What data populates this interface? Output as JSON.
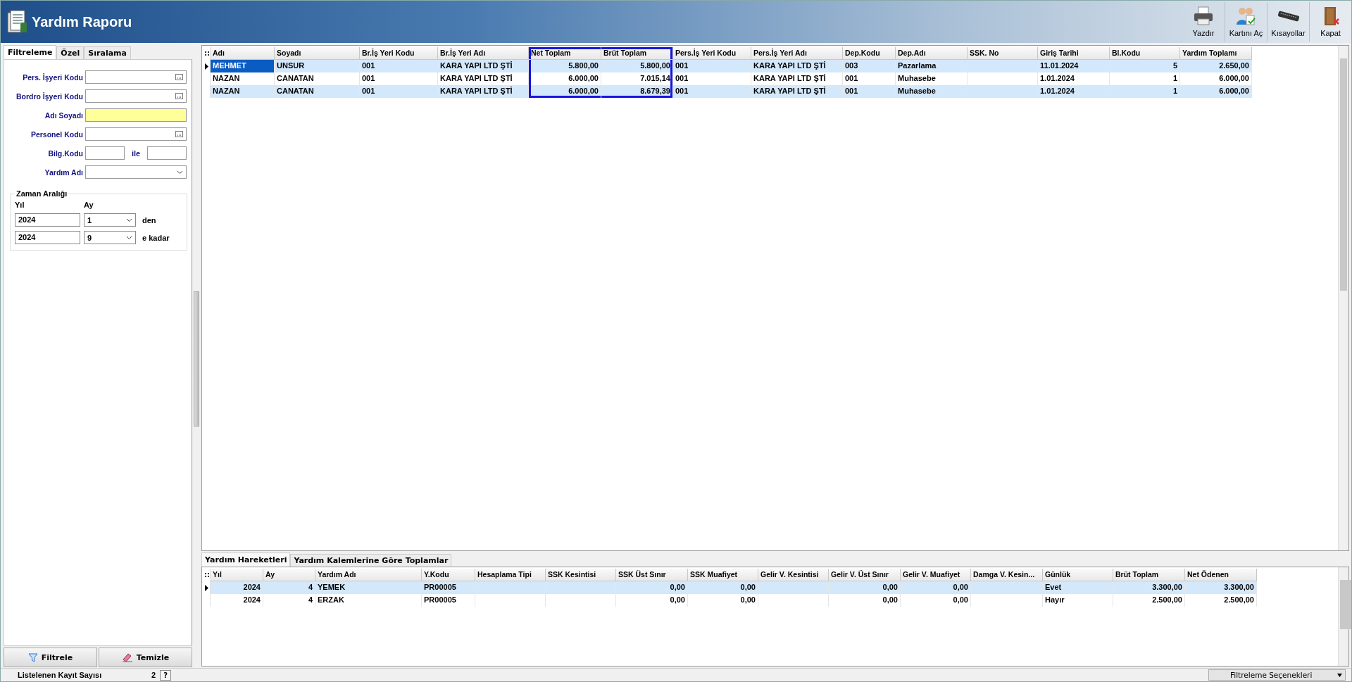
{
  "window": {
    "title": "Yardım Raporu"
  },
  "toolbar": [
    {
      "label": "Yazdır",
      "kind": "printer"
    },
    {
      "label": "Kartını Aç",
      "kind": "users"
    },
    {
      "label": "Kısayollar",
      "kind": "keyboard"
    },
    {
      "label": "Kapat",
      "kind": "exit"
    }
  ],
  "filter_panel": {
    "tabs": [
      {
        "label": "Filtreleme",
        "selected": true
      },
      {
        "label": "Özel",
        "selected": false
      },
      {
        "label": "Sıralama",
        "selected": false
      }
    ],
    "fields": [
      {
        "label": "Pers. İşyeri Kodu",
        "kind": "lookup",
        "focused": false
      },
      {
        "label": "Bordro İşyeri Kodu",
        "kind": "lookup",
        "focused": false
      },
      {
        "label": "Adı Soyadı",
        "kind": "text",
        "focused": true
      },
      {
        "label": "Personel Kodu",
        "kind": "lookup",
        "focused": false
      },
      {
        "label": "Bilg.Kodu",
        "kind": "range",
        "joiner": "ile",
        "focused": false
      },
      {
        "label": "Yardım Adı",
        "kind": "dropdown",
        "focused": false
      }
    ],
    "date_range": {
      "title": "Zaman Aralığı",
      "year_label": "Yıl",
      "month_label": "Ay",
      "rows": [
        {
          "year": "2024",
          "month": "1",
          "suffix": "den"
        },
        {
          "year": "2024",
          "month": "9",
          "suffix": "e kadar"
        }
      ]
    },
    "buttons": [
      {
        "label": "Filtrele",
        "kind": "filter"
      },
      {
        "label": "Temizle",
        "kind": "clear"
      }
    ]
  },
  "main_table": {
    "columns": [
      {
        "label": "Adı",
        "kind": "text",
        "highlighted": false
      },
      {
        "label": "Soyadı",
        "kind": "text",
        "highlighted": false
      },
      {
        "label": "Br.İş Yeri Kodu",
        "kind": "text",
        "highlighted": false
      },
      {
        "label": "Br.İş Yeri Adı",
        "kind": "text",
        "highlighted": false
      },
      {
        "label": "Net Toplam",
        "kind": "number",
        "highlighted": true
      },
      {
        "label": "Brüt Toplam",
        "kind": "number",
        "highlighted": true
      },
      {
        "label": "Pers.İş Yeri Kodu",
        "kind": "text",
        "highlighted": false
      },
      {
        "label": "Pers.İş Yeri Adı",
        "kind": "text",
        "highlighted": false
      },
      {
        "label": "Dep.Kodu",
        "kind": "text",
        "highlighted": false
      },
      {
        "label": "Dep.Adı",
        "kind": "text",
        "highlighted": false
      },
      {
        "label": "SSK. No",
        "kind": "text",
        "highlighted": false
      },
      {
        "label": "Giriş Tarihi",
        "kind": "text",
        "highlighted": false
      },
      {
        "label": "Bl.Kodu",
        "kind": "number",
        "highlighted": false
      },
      {
        "label": "Yardım Toplamı",
        "kind": "number",
        "highlighted": false
      }
    ],
    "rows": [
      {
        "selected": true,
        "cells": [
          "MEHMET",
          "UNSUR",
          "001",
          "KARA YAPI LTD ŞTİ",
          "5.800,00",
          "5.800,00",
          "001",
          "KARA YAPI LTD ŞTİ",
          "003",
          "Pazarlama",
          "",
          "11.01.2024",
          "5",
          "2.650,00"
        ]
      },
      {
        "selected": false,
        "cells": [
          "NAZAN",
          "CANATAN",
          "001",
          "KARA YAPI LTD ŞTİ",
          "6.000,00",
          "7.015,14",
          "001",
          "KARA YAPI LTD ŞTİ",
          "001",
          "Muhasebe",
          "",
          "1.01.2024",
          "1",
          "6.000,00"
        ]
      },
      {
        "selected": false,
        "cells": [
          "NAZAN",
          "CANATAN",
          "001",
          "KARA YAPI LTD ŞTİ",
          "6.000,00",
          "8.679,39",
          "001",
          "KARA YAPI LTD ŞTİ",
          "001",
          "Muhasebe",
          "",
          "1.01.2024",
          "1",
          "6.000,00"
        ]
      }
    ]
  },
  "detail_tabs": [
    {
      "label": "Yardım Hareketleri",
      "selected": true
    },
    {
      "label": "Yardım Kalemlerine Göre Toplamlar",
      "selected": false
    }
  ],
  "detail_table": {
    "columns": [
      {
        "label": "Yıl",
        "kind": "number"
      },
      {
        "label": "Ay",
        "kind": "number"
      },
      {
        "label": "Yardım Adı",
        "kind": "text"
      },
      {
        "label": "Y.Kodu",
        "kind": "text"
      },
      {
        "label": "Hesaplama Tipi",
        "kind": "text"
      },
      {
        "label": "SSK Kesintisi",
        "kind": "number"
      },
      {
        "label": "SSK Üst Sınır",
        "kind": "number"
      },
      {
        "label": "SSK Muafiyet",
        "kind": "number"
      },
      {
        "label": "Gelir V. Kesintisi",
        "kind": "number"
      },
      {
        "label": "Gelir V. Üst Sınır",
        "kind": "number"
      },
      {
        "label": "Gelir V. Muafiyet",
        "kind": "number"
      },
      {
        "label": "Damga V. Kesin...",
        "kind": "number"
      },
      {
        "label": "Günlük",
        "kind": "text"
      },
      {
        "label": "Brüt Toplam",
        "kind": "number"
      },
      {
        "label": "Net Ödenen",
        "kind": "number"
      }
    ],
    "rows": [
      {
        "selected": true,
        "cells": [
          "2024",
          "4",
          "YEMEK",
          "PR00005",
          "",
          "",
          "0,00",
          "0,00",
          "",
          "0,00",
          "0,00",
          "",
          "Evet",
          "3.300,00",
          "3.300,00"
        ]
      },
      {
        "selected": false,
        "cells": [
          "2024",
          "4",
          "ERZAK",
          "PR00005",
          "",
          "",
          "0,00",
          "0,00",
          "",
          "0,00",
          "0,00",
          "",
          "Hayır",
          "2.500,00",
          "2.500,00"
        ]
      }
    ]
  },
  "status_bar": {
    "label": "Listelenen Kayıt Sayısı",
    "count": "2",
    "help": "?",
    "options": "Filtreleme Seçenekleri"
  }
}
